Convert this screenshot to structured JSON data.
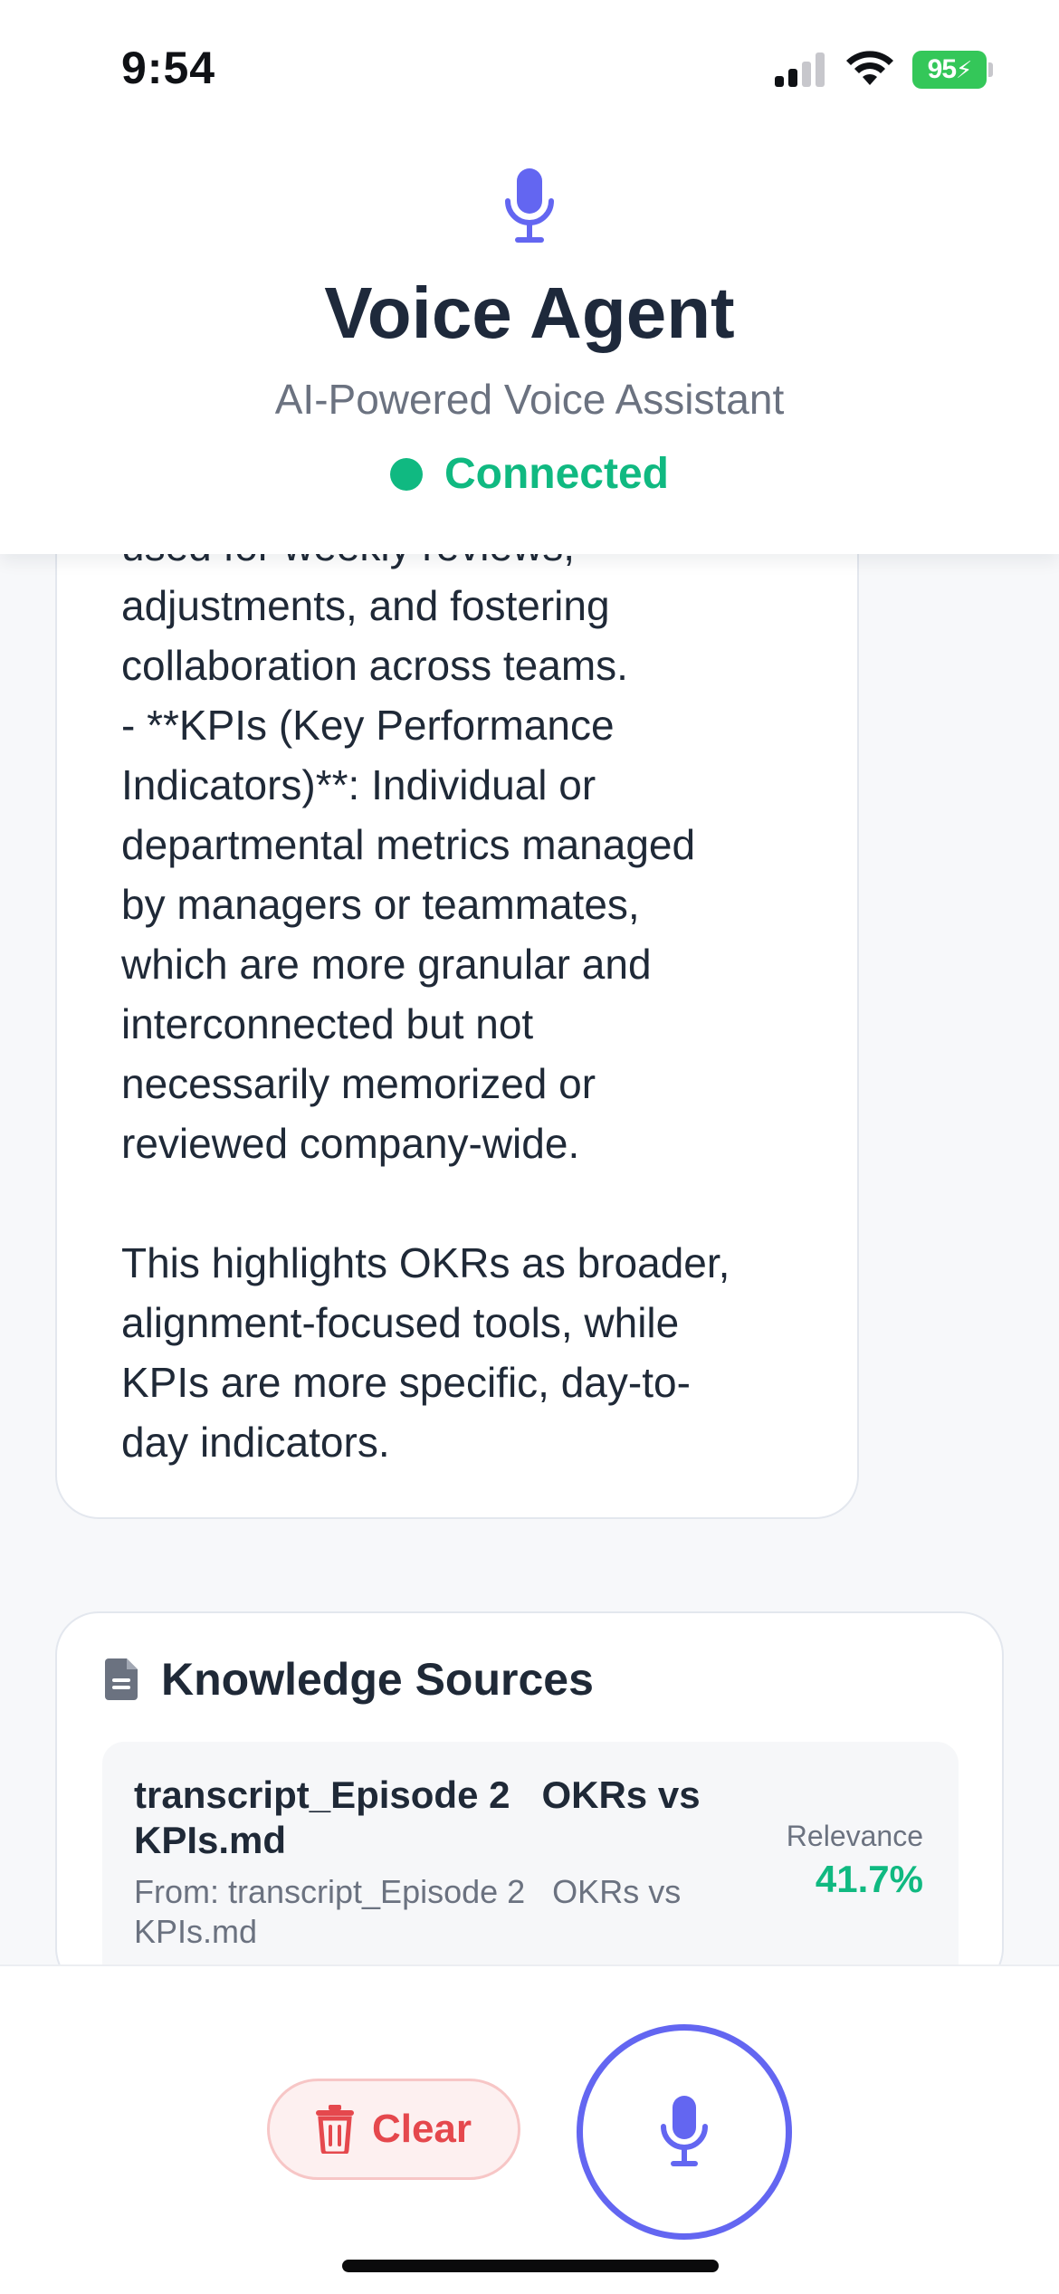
{
  "status_bar": {
    "time": "9:54",
    "battery": "95"
  },
  "header": {
    "title": "Voice Agent",
    "subtitle": "AI-Powered Voice Assistant",
    "status": "Connected",
    "status_color": "#10b981",
    "icon": "microphone-icon"
  },
  "message": {
    "text": "used for weekly reviews,\nadjustments, and fostering\ncollaboration across teams.\n- **KPIs (Key Performance\nIndicators)**: Individual or\ndepartmental metrics managed\nby managers or teammates,\nwhich are more granular and\ninterconnected but not\nnecessarily memorized or\nreviewed company-wide.\n\nThis highlights OKRs as broader,\nalignment-focused tools, while\nKPIs are more specific, day-to-\nday indicators."
  },
  "knowledge_sources": {
    "title": "Knowledge Sources",
    "icon": "document-icon",
    "items": [
      {
        "name": "transcript_Episode 2   OKRs vs KPIs.md",
        "from": "From: transcript_Episode 2   OKRs vs KPIs.md",
        "relevance_label": "Relevance",
        "relevance": "41.7%"
      }
    ]
  },
  "controls": {
    "clear_label": "Clear",
    "clear_icon": "trash-icon",
    "mic_icon": "microphone-icon"
  },
  "colors": {
    "accent": "#6366f1",
    "success": "#10b981",
    "danger": "#e5484d"
  }
}
